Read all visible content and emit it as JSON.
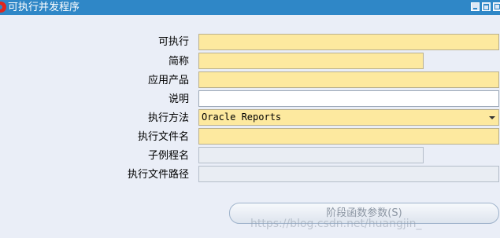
{
  "window": {
    "title": "可执行并发程序"
  },
  "form": {
    "executable": {
      "label": "可执行",
      "value": ""
    },
    "short_name": {
      "label": "简称",
      "value": ""
    },
    "application": {
      "label": "应用产品",
      "value": ""
    },
    "description": {
      "label": "说明",
      "value": ""
    },
    "execution_method": {
      "label": "执行方法",
      "value": "Oracle Reports"
    },
    "execution_file_name": {
      "label": "执行文件名",
      "value": ""
    },
    "subroutine_name": {
      "label": "子例程名",
      "value": ""
    },
    "execution_file_path": {
      "label": "执行文件路径",
      "value": ""
    }
  },
  "buttons": {
    "stage_params": "阶段函数参数(S)"
  },
  "watermark": "https://blog.csdn.net/huangjin_",
  "colors": {
    "titlebar": "#2f87c7",
    "required_field": "#fde99f",
    "background": "#eaeef7"
  }
}
